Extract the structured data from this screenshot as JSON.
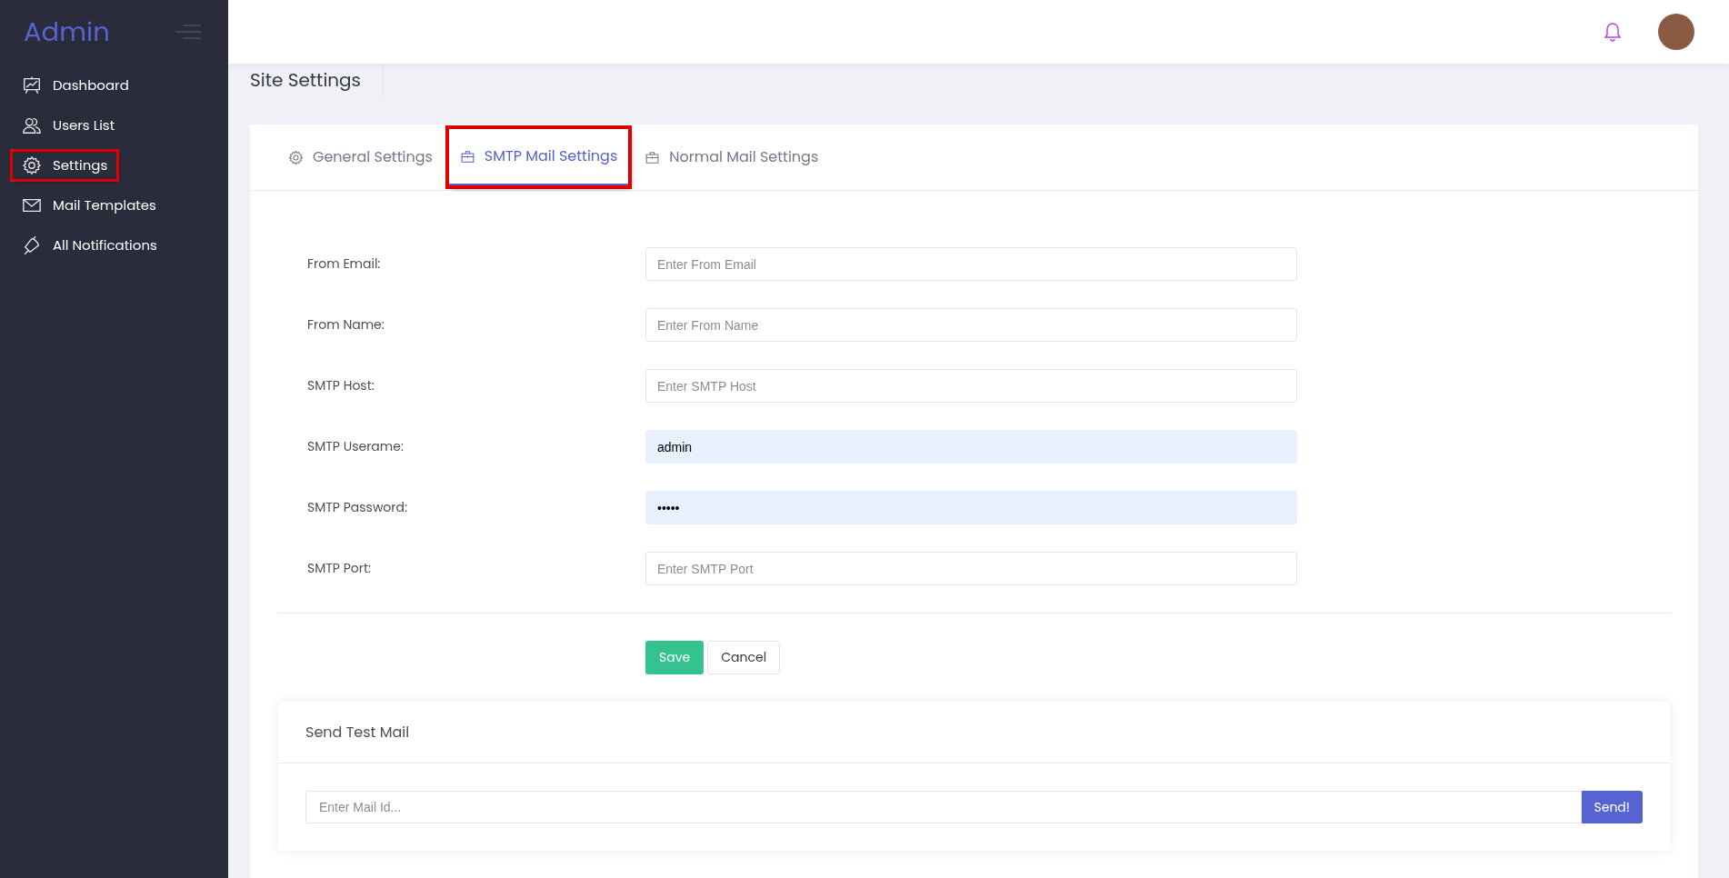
{
  "sidebar": {
    "logo": "Admin",
    "items": [
      {
        "label": "Dashboard",
        "highlighted": false
      },
      {
        "label": "Users List",
        "highlighted": false
      },
      {
        "label": "Settings",
        "highlighted": true
      },
      {
        "label": "Mail Templates",
        "highlighted": false
      },
      {
        "label": "All Notifications",
        "highlighted": false
      }
    ]
  },
  "page_title": "Site Settings",
  "tabs": [
    {
      "label": "General Settings",
      "selected": false,
      "highlighted": false
    },
    {
      "label": "SMTP Mail Settings",
      "selected": true,
      "highlighted": true
    },
    {
      "label": "Normal Mail Settings",
      "selected": false,
      "highlighted": false
    }
  ],
  "form": [
    {
      "label": "From Email:",
      "placeholder": "Enter From Email"
    },
    {
      "label": "From Name:",
      "placeholder": "Enter From Name"
    },
    {
      "label": "SMTP Host:",
      "placeholder": "Enter SMTP Host"
    },
    {
      "label": "SMTP Userame:",
      "value": "admin"
    },
    {
      "label": "SMTP Password:",
      "value": "•••••"
    },
    {
      "label": "SMTP Port:",
      "placeholder": "Enter SMTP Port"
    }
  ],
  "buttons": {
    "save": "Save",
    "cancel": "Cancel"
  },
  "test_mail": {
    "title": "Send Test Mail",
    "placeholder": "Enter Mail Id...",
    "button": "Send!"
  }
}
